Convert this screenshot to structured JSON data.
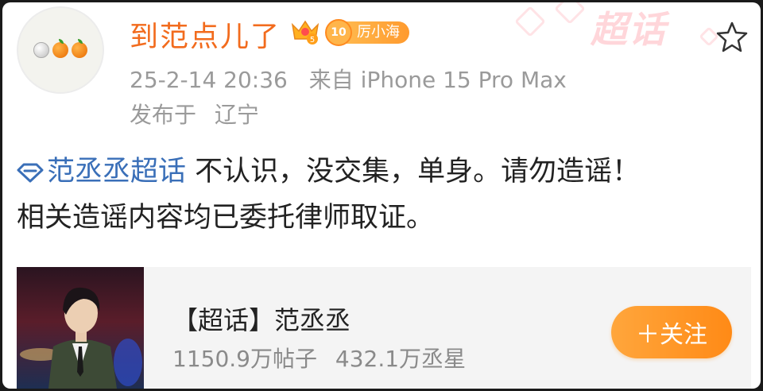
{
  "post": {
    "username": "到范点儿了",
    "level_number": "10",
    "level_name": "厉小海",
    "time": "25-2-14 20:36",
    "source": "来自 iPhone 15 Pro Max",
    "location_prefix": "发布于",
    "location": "辽宁",
    "topic_link": "范丞丞超话",
    "text_line1": " 不认识，没交集，单身。请勿造谣！",
    "text_line2": "相关造谣内容均已委托律师取证。"
  },
  "watermark": {
    "text": "超话"
  },
  "card": {
    "title": "【超话】范丞丞",
    "posts": "1150.9万帖子",
    "fans": "432.1万丞星",
    "follow_label": "＋关注"
  },
  "colors": {
    "username": "#f26b1d",
    "link": "#3a6fb8",
    "meta": "#9a9a9a",
    "follow": "#ff8a16"
  },
  "icons": [
    "avatar-emoji",
    "crown-icon",
    "level-badge",
    "star-icon",
    "topic-diamond-icon"
  ]
}
